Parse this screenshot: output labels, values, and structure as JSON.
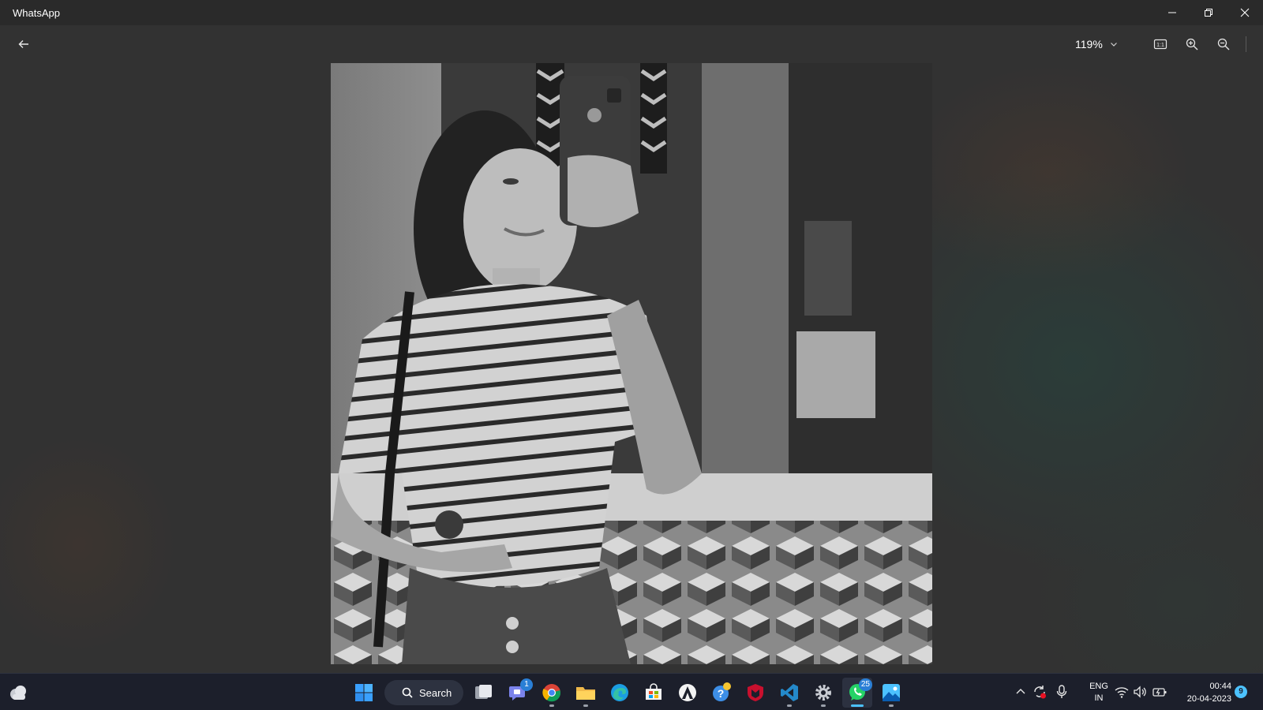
{
  "window": {
    "title": "WhatsApp",
    "controls": [
      "minimize",
      "restore",
      "close"
    ]
  },
  "viewer": {
    "back_icon": "arrow-left-icon",
    "zoom_value": "119%",
    "tools": [
      "actual-size-icon",
      "zoom-in-icon",
      "zoom-out-icon"
    ],
    "image_description_icon": "photo"
  },
  "taskbar": {
    "weather_icon": "weather-cloud-icon",
    "search_label": "Search",
    "apps": [
      {
        "name": "start",
        "icon": "windows-logo-icon"
      },
      {
        "name": "task-view",
        "icon": "task-view-icon"
      },
      {
        "name": "teams-chat",
        "icon": "teams-chat-icon",
        "badge": "1"
      },
      {
        "name": "chrome",
        "icon": "chrome-icon"
      },
      {
        "name": "file-explorer",
        "icon": "folder-icon"
      },
      {
        "name": "edge",
        "icon": "edge-icon"
      },
      {
        "name": "microsoft-store",
        "icon": "store-icon"
      },
      {
        "name": "app-arch",
        "icon": "arch-icon"
      },
      {
        "name": "get-help",
        "icon": "help-icon"
      },
      {
        "name": "mcafee",
        "icon": "mcafee-shield-icon"
      },
      {
        "name": "vs-code",
        "icon": "vscode-icon"
      },
      {
        "name": "settings",
        "icon": "gear-icon"
      },
      {
        "name": "whatsapp",
        "icon": "whatsapp-icon",
        "badge": "25"
      },
      {
        "name": "photos",
        "icon": "photos-icon"
      }
    ],
    "tray": {
      "language_line1": "ENG",
      "language_line2": "IN",
      "time": "00:44",
      "date": "20-04-2023",
      "notifications": "9"
    }
  },
  "colors": {
    "taskbar_bg": "#1c1f2b",
    "accent": "#4cc2ff",
    "titlebar_bg": "#2a2a2a"
  }
}
